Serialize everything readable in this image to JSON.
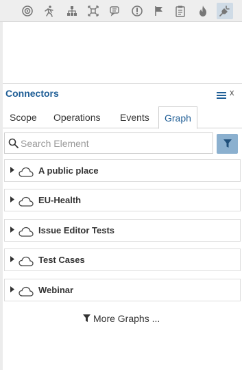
{
  "toolbar": {
    "icons": [
      {
        "name": "target-icon"
      },
      {
        "name": "run-icon"
      },
      {
        "name": "hierarchy-icon"
      },
      {
        "name": "expand-icon"
      },
      {
        "name": "comments-icon"
      },
      {
        "name": "alert-icon"
      },
      {
        "name": "flag-icon"
      },
      {
        "name": "clipboard-icon"
      },
      {
        "name": "fire-icon"
      },
      {
        "name": "plug-icon",
        "active": true
      }
    ]
  },
  "panel": {
    "title": "Connectors",
    "close_label": "x",
    "tabs": [
      {
        "label": "Scope"
      },
      {
        "label": "Operations"
      },
      {
        "label": "Events"
      },
      {
        "label": "Graph",
        "active": true
      }
    ],
    "search": {
      "placeholder": "Search Element",
      "value": ""
    },
    "graphs": [
      {
        "label": "A public place"
      },
      {
        "label": "EU-Health"
      },
      {
        "label": "Issue Editor Tests"
      },
      {
        "label": "Test Cases"
      },
      {
        "label": "Webinar"
      }
    ],
    "more_label": "More Graphs ..."
  },
  "colors": {
    "accent": "#1f5e96",
    "filter_button": "#8bb0cf",
    "toolbar_bg": "#eeeeee"
  }
}
